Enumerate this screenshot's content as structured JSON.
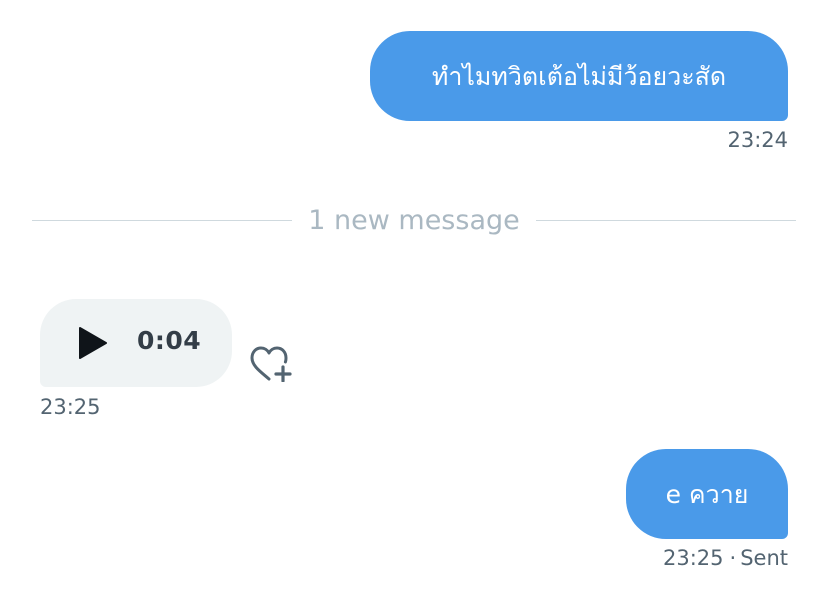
{
  "conversation": {
    "messages": [
      {
        "direction": "outgoing",
        "text": "ทำไมทวิตเต้อไม่มีว้อยวะสัด",
        "time": "23:24"
      },
      {
        "direction": "incoming",
        "type": "voice",
        "duration": "0:04",
        "time": "23:25"
      },
      {
        "direction": "outgoing",
        "text": "e ควาย",
        "time": "23:25",
        "status": "Sent"
      }
    ],
    "divider_text": "1 new message"
  },
  "icons": {
    "play": "play-icon",
    "react": "heart-plus-icon"
  },
  "colors": {
    "outgoing_bubble": "#4a9ae9",
    "incoming_bubble": "#eff3f4",
    "meta_text": "#536471",
    "divider_text": "#aab8c2"
  }
}
